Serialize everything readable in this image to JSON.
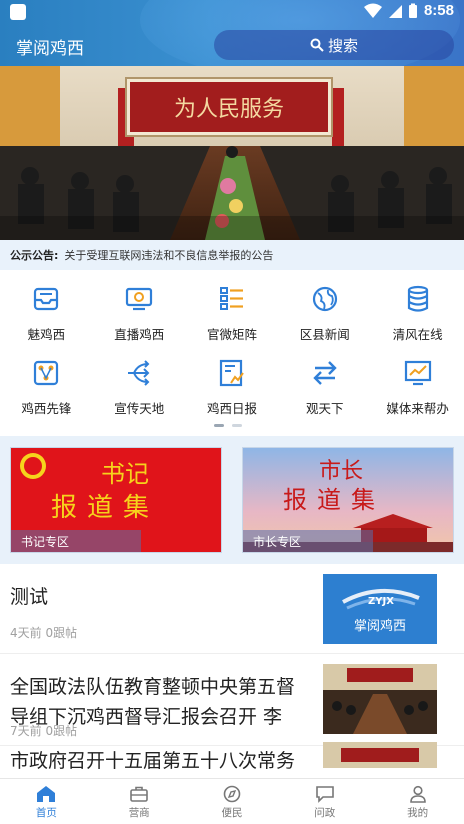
{
  "status_bar": {
    "time": "8:58"
  },
  "header": {
    "title": "掌阅鸡西",
    "search_label": "搜索"
  },
  "banner": {
    "slogan": "为人民服务"
  },
  "notice": {
    "label": "公示公告:",
    "text": "关于受理互联网违法和不良信息举报的公告"
  },
  "grid": {
    "items": [
      {
        "label": "魅鸡西",
        "icon": "inbox-icon"
      },
      {
        "label": "直播鸡西",
        "icon": "tv-icon"
      },
      {
        "label": "官微矩阵",
        "icon": "matrix-icon"
      },
      {
        "label": "区县新闻",
        "icon": "globe-icon"
      },
      {
        "label": "清风在线",
        "icon": "database-icon"
      },
      {
        "label": "鸡西先锋",
        "icon": "network-icon"
      },
      {
        "label": "宣传天地",
        "icon": "share-icon"
      },
      {
        "label": "鸡西日报",
        "icon": "newspaper-icon"
      },
      {
        "label": "观天下",
        "icon": "swap-icon"
      },
      {
        "label": "媒体来帮办",
        "icon": "chart-icon"
      }
    ]
  },
  "special": {
    "left": {
      "title_line1": "书记",
      "title_line2": "报道集",
      "caption": "书记专区"
    },
    "right": {
      "title_line1": "市长",
      "title_line2": "报道集",
      "caption": "市长专区"
    }
  },
  "news": [
    {
      "title": "测试",
      "time": "4天前",
      "follows": "0跟帖",
      "thumb_text": "ZYJX",
      "thumb_text2": "掌阅鸡西"
    },
    {
      "title": "全国政法队伍教育整顿中央第五督导组下沉鸡西督导汇报会召开 李",
      "time": "7天前",
      "follows": "0跟帖"
    },
    {
      "title": "市政府召开十五届第五十八次常务"
    }
  ],
  "tabs": [
    {
      "label": "首页",
      "icon": "home-icon",
      "active": true
    },
    {
      "label": "营商",
      "icon": "briefcase-icon",
      "active": false
    },
    {
      "label": "便民",
      "icon": "compass-icon",
      "active": false
    },
    {
      "label": "问政",
      "icon": "message-icon",
      "active": false
    },
    {
      "label": "我的",
      "icon": "user-icon",
      "active": false
    }
  ],
  "colors": {
    "brand": "#2f7fd8",
    "header": "#2a7fc0",
    "notice_bg": "#e9f2fb",
    "special_bg": "#e8f1fa"
  }
}
